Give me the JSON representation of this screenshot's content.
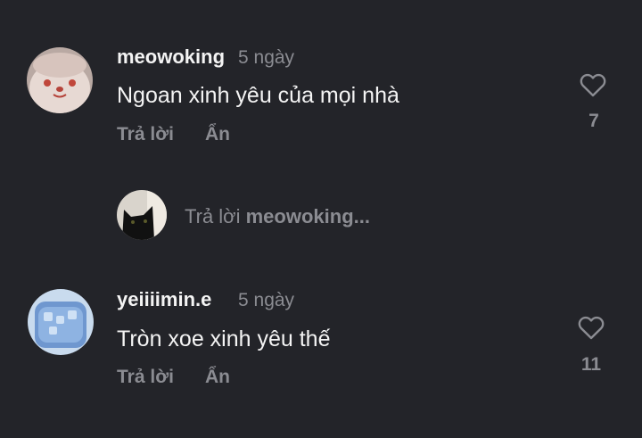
{
  "comments": [
    {
      "username": "meowoking",
      "time": "5 ngày",
      "text": "Ngoan xinh yêu của mọi nhà",
      "reply_label": "Trả lời",
      "hide_label": "Ẩn",
      "likes": "7",
      "avatar_icon": "plush-face-avatar"
    },
    {
      "username": "yeiiiimin.e",
      "time": "5 ngày",
      "text": "Tròn xoe xinh yêu thế",
      "reply_label": "Trả lời",
      "hide_label": "Ẩn",
      "likes": "11",
      "avatar_icon": "blue-drink-avatar"
    }
  ],
  "reply_box": {
    "prefix": "Trả lời",
    "target": "meowoking...",
    "avatar_icon": "black-cat-avatar"
  },
  "colors": {
    "background": "#232429",
    "text": "#f4f4f4",
    "muted": "#8b8c92"
  },
  "icons": {
    "like": "heart-outline-icon"
  }
}
